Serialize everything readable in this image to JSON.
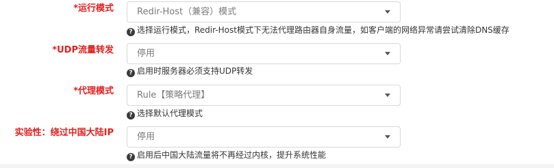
{
  "fields": [
    {
      "label": "*运行模式",
      "value": "Redir-Host（兼容）模式",
      "help": "选择运行模式，Redir-Host模式下无法代理路由器自身流量，如客户端的网络异常请尝试清除DNS缓存"
    },
    {
      "label": "*UDP流量转发",
      "value": "停用",
      "help": "启用时服务器必须支持UDP转发"
    },
    {
      "label": "*代理模式",
      "value": "Rule【策略代理】",
      "help": "选择默认代理模式"
    },
    {
      "label": "实验性：绕过中国大陆IP",
      "value": "停用",
      "help": "启用后中国大陆流量将不再经过内核，提升系统性能"
    }
  ],
  "icons": {
    "help": "question-circle-icon",
    "dropdown": "caret-down-icon"
  },
  "colors": {
    "label": "#e02020",
    "border": "#d7d7d7",
    "value_text": "#7a7a7a"
  }
}
